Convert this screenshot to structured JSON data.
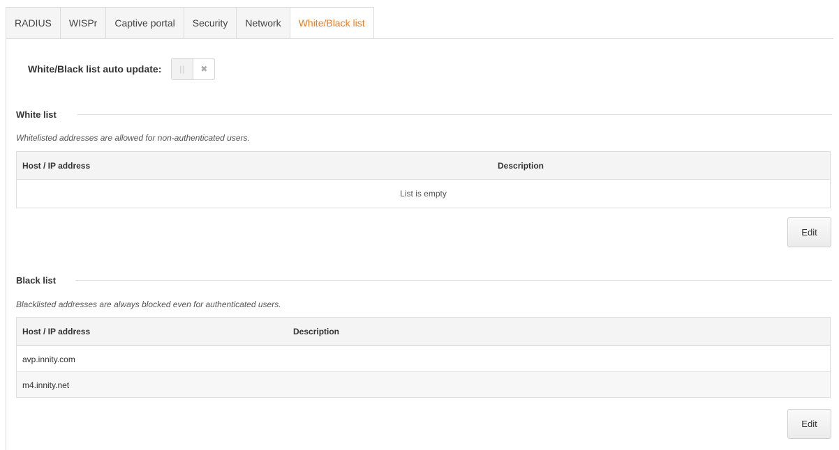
{
  "tabs": [
    {
      "label": "RADIUS"
    },
    {
      "label": "WISPr"
    },
    {
      "label": "Captive portal"
    },
    {
      "label": "Security"
    },
    {
      "label": "Network"
    },
    {
      "label": "White/Black list"
    }
  ],
  "active_tab": "White/Black list",
  "auto_update": {
    "label": "White/Black list auto update:",
    "on_glyph": "||",
    "off_glyph": "✖",
    "state": "off"
  },
  "white_list": {
    "title": "White list",
    "description": "Whitelisted addresses are allowed for non-authenticated users.",
    "columns": [
      "Host / IP address",
      "Description"
    ],
    "rows": [],
    "empty_text": "List is empty",
    "edit_label": "Edit"
  },
  "black_list": {
    "title": "Black list",
    "description": "Blacklisted addresses are always blocked even for authenticated users.",
    "columns": [
      "Host / IP address",
      "Description"
    ],
    "rows": [
      {
        "host": "avp.innity.com",
        "description": ""
      },
      {
        "host": "m4.innity.net",
        "description": ""
      }
    ],
    "edit_label": "Edit"
  },
  "colors": {
    "active_tab": "#e67e22",
    "border": "#dcdcdc",
    "header_bg": "#f4f4f4"
  }
}
